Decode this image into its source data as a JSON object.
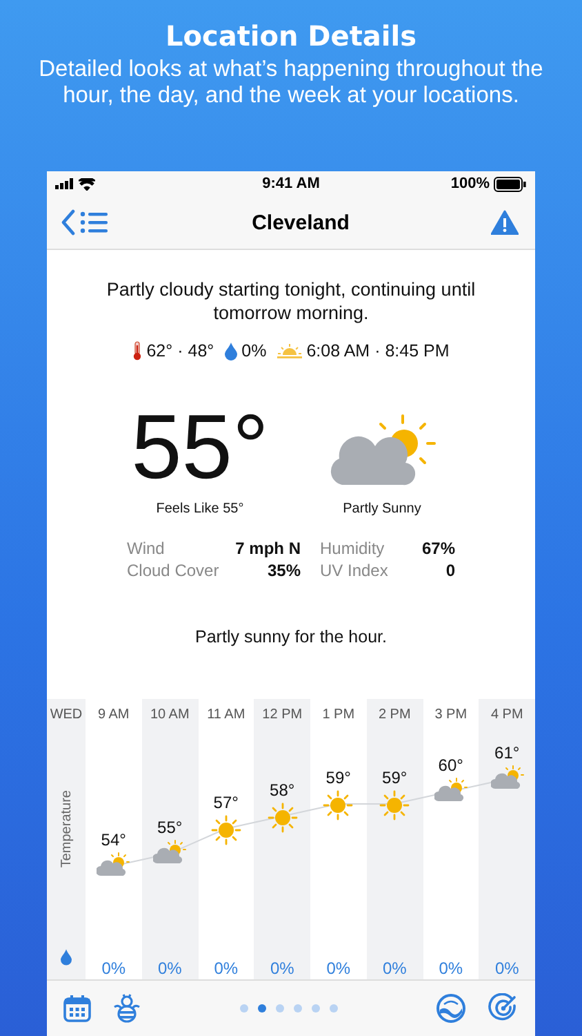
{
  "promo": {
    "title": "Location Details",
    "subtitle": "Detailed looks at what’s happening throughout the hour, the day, and the week at your locations."
  },
  "status_bar": {
    "time": "9:41 AM",
    "battery": "100%"
  },
  "nav": {
    "title": "Cleveland"
  },
  "summary": "Partly cloudy starting tonight, continuing until tomorrow morning.",
  "day_stats": {
    "temps": "62° · 48°",
    "precip": "0%",
    "sun": "6:08 AM · 8:45 PM"
  },
  "current": {
    "temp": "55°",
    "feels_like": "Feels Like 55°",
    "condition": "Partly Sunny"
  },
  "details": [
    {
      "label": "Wind",
      "value": "7 mph N"
    },
    {
      "label": "Humidity",
      "value": "67%"
    },
    {
      "label": "Cloud Cover",
      "value": "35%"
    },
    {
      "label": "UV Index",
      "value": "0"
    }
  ],
  "hour_summary": "Partly sunny for the hour.",
  "hourly": {
    "day": "WED",
    "axis_label": "Temperature",
    "hours": [
      {
        "time": "9 AM",
        "temp": "54°",
        "kind": "partly",
        "precip": "0%"
      },
      {
        "time": "10 AM",
        "temp": "55°",
        "kind": "partly",
        "precip": "0%"
      },
      {
        "time": "11 AM",
        "temp": "57°",
        "kind": "sunny",
        "precip": "0%"
      },
      {
        "time": "12 PM",
        "temp": "58°",
        "kind": "sunny",
        "precip": "0%"
      },
      {
        "time": "1 PM",
        "temp": "59°",
        "kind": "sunny",
        "precip": "0%"
      },
      {
        "time": "2 PM",
        "temp": "59°",
        "kind": "sunny",
        "precip": "0%"
      },
      {
        "time": "3 PM",
        "temp": "60°",
        "kind": "partly",
        "precip": "0%"
      },
      {
        "time": "4 PM",
        "temp": "61°",
        "kind": "partly",
        "precip": "0%"
      }
    ]
  },
  "page_dots": [
    {
      "selected": false
    },
    {
      "selected": true
    },
    {
      "selected": false
    },
    {
      "selected": false
    },
    {
      "selected": false
    },
    {
      "selected": false
    }
  ]
}
